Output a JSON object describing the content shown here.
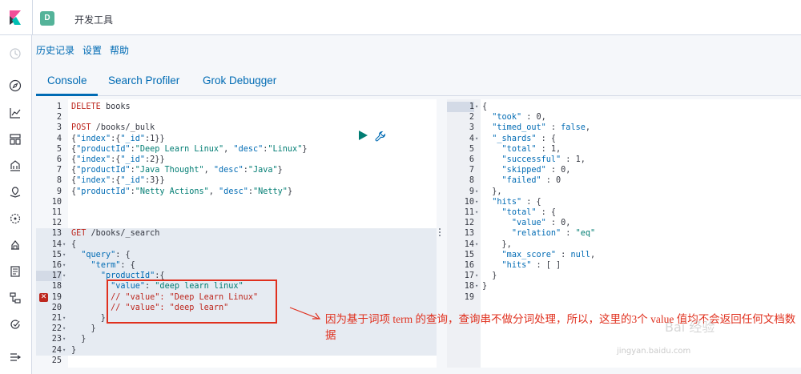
{
  "header": {
    "space_initial": "D",
    "title": "开发工具"
  },
  "menu_links": [
    "历史记录",
    "设置",
    "帮助"
  ],
  "tabs": [
    {
      "label": "Console",
      "selected": true
    },
    {
      "label": "Search Profiler",
      "selected": false
    },
    {
      "label": "Grok Debugger",
      "selected": false
    }
  ],
  "nav_icons": [
    "clock-icon",
    "compass-icon",
    "visualize-icon",
    "dashboard-icon",
    "canvas-icon",
    "maps-icon",
    "ml-icon",
    "infrastructure-icon",
    "logs-icon",
    "apm-icon",
    "uptime-icon",
    "collapse-icon"
  ],
  "request_lines": [
    {
      "n": "1",
      "text": "DELETE books"
    },
    {
      "n": "2",
      "text": ""
    },
    {
      "n": "3",
      "text": "POST /books/_bulk"
    },
    {
      "n": "4",
      "text": "{\"index\":{\"_id\":1}}"
    },
    {
      "n": "5",
      "text": "{\"productId\":\"Deep Learn Linux\", \"desc\":\"Linux\"}"
    },
    {
      "n": "6",
      "text": "{\"index\":{\"_id\":2}}"
    },
    {
      "n": "7",
      "text": "{\"productId\":\"Java Thought\", \"desc\":\"Java\"}"
    },
    {
      "n": "8",
      "text": "{\"index\":{\"_id\":3}}"
    },
    {
      "n": "9",
      "text": "{\"productId\":\"Netty Actions\", \"desc\":\"Netty\"}"
    },
    {
      "n": "10",
      "text": ""
    },
    {
      "n": "11",
      "text": ""
    },
    {
      "n": "12",
      "text": ""
    },
    {
      "n": "13",
      "text": "GET /books/_search"
    },
    {
      "n": "14",
      "text": "{"
    },
    {
      "n": "15",
      "text": "  \"query\": {"
    },
    {
      "n": "16",
      "text": "    \"term\": {"
    },
    {
      "n": "17",
      "text": "      \"productId\":{"
    },
    {
      "n": "18",
      "text": "        \"value\": \"deep learn linux\""
    },
    {
      "n": "19",
      "text": "        // \"value\": \"Deep Learn Linux\""
    },
    {
      "n": "20",
      "text": "        // \"value\": \"deep learn\""
    },
    {
      "n": "21",
      "text": "      }"
    },
    {
      "n": "22",
      "text": "    }"
    },
    {
      "n": "23",
      "text": "  }"
    },
    {
      "n": "24",
      "text": "}"
    },
    {
      "n": "25",
      "text": ""
    }
  ],
  "response_lines": [
    {
      "n": "1",
      "text": "{"
    },
    {
      "n": "2",
      "text": "  \"took\" : 0,"
    },
    {
      "n": "3",
      "text": "  \"timed_out\" : false,"
    },
    {
      "n": "4",
      "text": "  \"_shards\" : {"
    },
    {
      "n": "5",
      "text": "    \"total\" : 1,"
    },
    {
      "n": "6",
      "text": "    \"successful\" : 1,"
    },
    {
      "n": "7",
      "text": "    \"skipped\" : 0,"
    },
    {
      "n": "8",
      "text": "    \"failed\" : 0"
    },
    {
      "n": "9",
      "text": "  },"
    },
    {
      "n": "10",
      "text": "  \"hits\" : {"
    },
    {
      "n": "11",
      "text": "    \"total\" : {"
    },
    {
      "n": "12",
      "text": "      \"value\" : 0,"
    },
    {
      "n": "13",
      "text": "      \"relation\" : \"eq\""
    },
    {
      "n": "14",
      "text": "    },"
    },
    {
      "n": "15",
      "text": "    \"max_score\" : null,"
    },
    {
      "n": "16",
      "text": "    \"hits\" : [ ]"
    },
    {
      "n": "17",
      "text": "  }"
    },
    {
      "n": "18",
      "text": "}"
    },
    {
      "n": "19",
      "text": ""
    }
  ],
  "annotation": {
    "note": "因为基于词项 term 的查询，查询串不做分词处理，所以，这里的3个 value 值均不会返回任何文档数据"
  },
  "watermark": {
    "brand": "Bai 经验",
    "url": "jingyan.baidu.com"
  },
  "colors": {
    "accent": "#006bb4",
    "keyword_red": "#bd271e",
    "string_green": "#017d73",
    "annotation_red": "#e0301e",
    "space_badge": "#54b399"
  }
}
